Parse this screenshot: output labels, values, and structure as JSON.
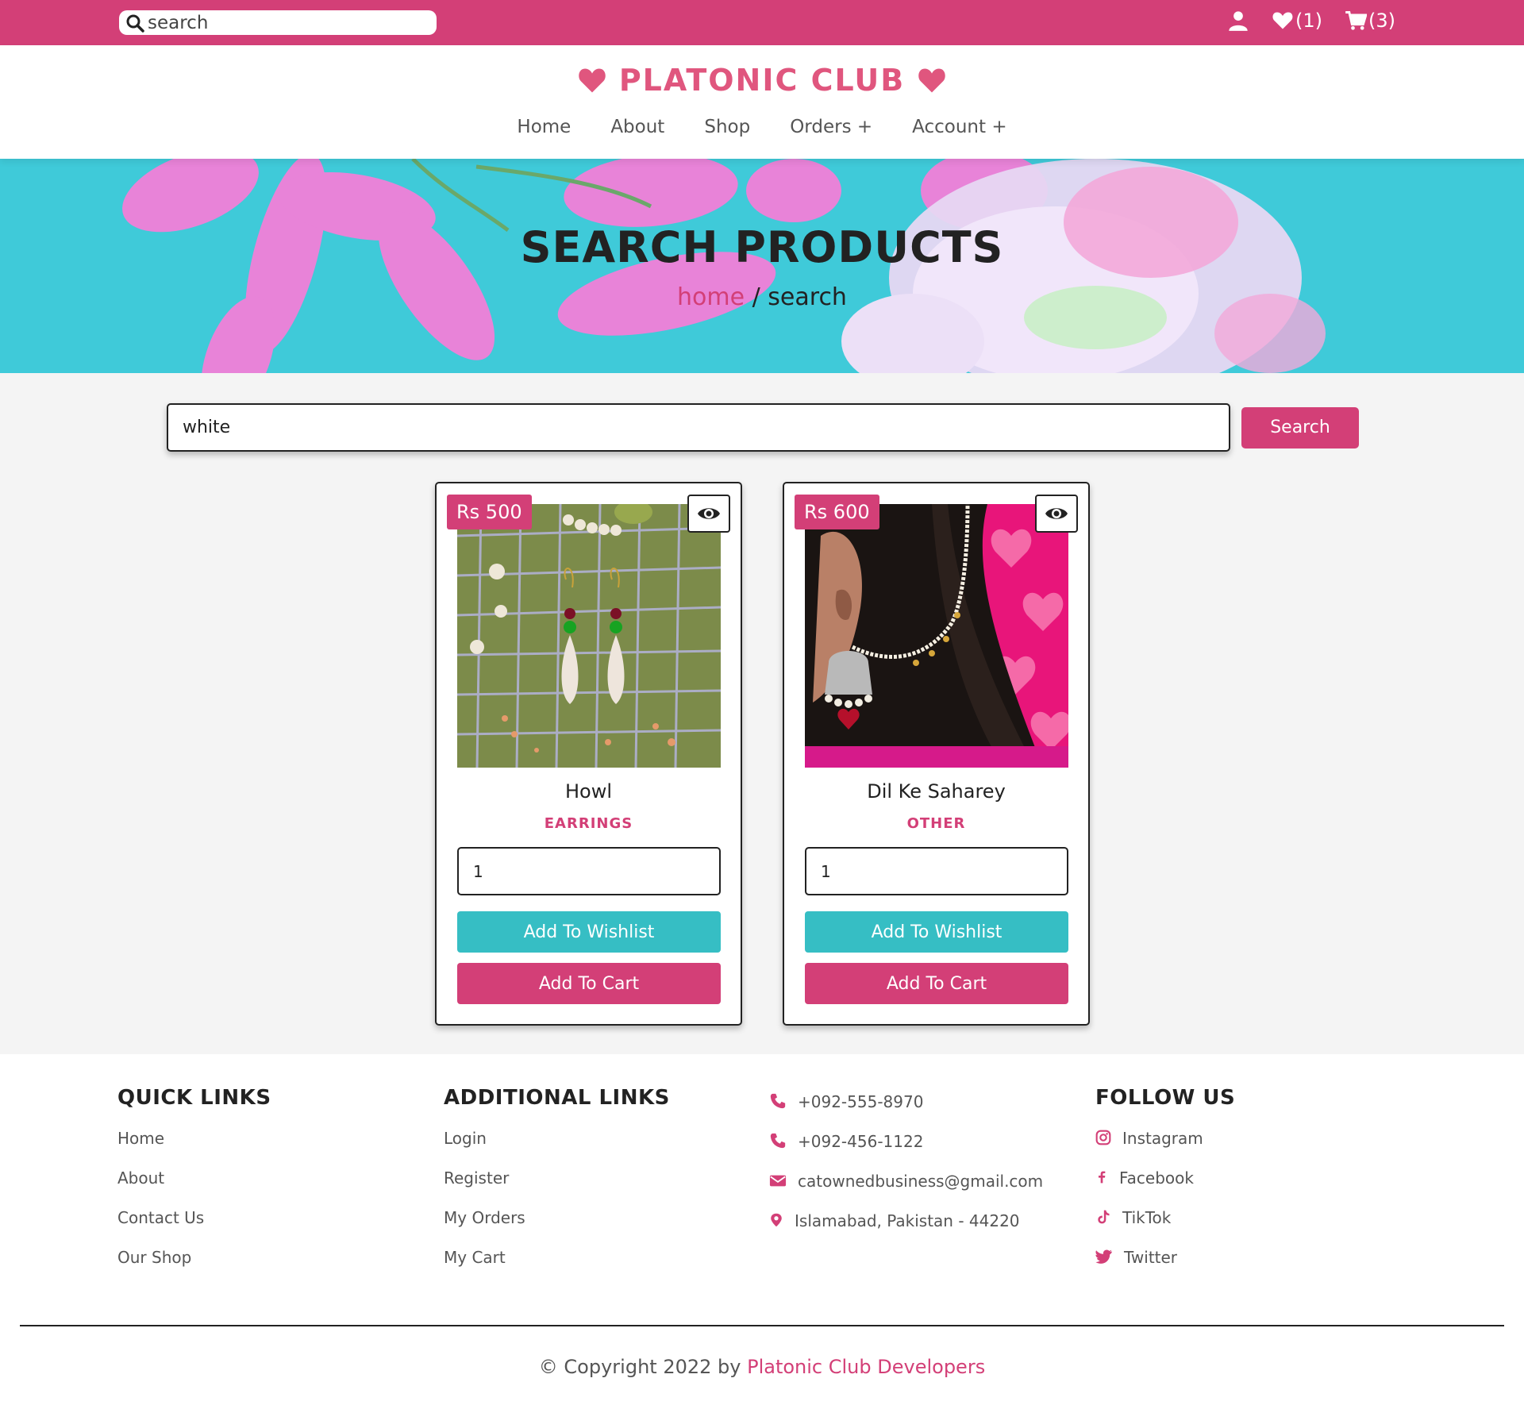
{
  "topbar": {
    "search_placeholder": "search",
    "wishlist_count": "(1)",
    "cart_count": "(3)"
  },
  "header": {
    "logo": "PLATONIC CLUB",
    "nav": [
      "Home",
      "About",
      "Shop",
      "Orders +",
      "Account +"
    ]
  },
  "hero": {
    "title": "SEARCH PRODUCTS",
    "crumb_home": "home",
    "crumb_sep": " / ",
    "crumb_current": "search"
  },
  "search": {
    "value": "white",
    "button": "Search"
  },
  "products": [
    {
      "price": "Rs 500",
      "name": "Howl",
      "category": "EARRINGS",
      "quantity": "1",
      "wishlist_label": "Add To Wishlist",
      "cart_label": "Add To Cart"
    },
    {
      "price": "Rs 600",
      "name": "Dil Ke Saharey",
      "category": "OTHER",
      "quantity": "1",
      "wishlist_label": "Add To Wishlist",
      "cart_label": "Add To Cart"
    }
  ],
  "footer": {
    "quick_links": {
      "title": "QUICK LINKS",
      "items": [
        "Home",
        "About",
        "Contact Us",
        "Our Shop"
      ]
    },
    "additional_links": {
      "title": "ADDITIONAL LINKS",
      "items": [
        "Login",
        "Register",
        "My Orders",
        "My Cart"
      ]
    },
    "contact": {
      "phone1": "+092-555-8970",
      "phone2": "+092-456-1122",
      "email": "catownedbusiness@gmail.com",
      "address": "Islamabad, Pakistan - 44220"
    },
    "follow": {
      "title": "FOLLOW US",
      "items": [
        "Instagram",
        "Facebook",
        "TikTok",
        "Twitter"
      ]
    },
    "copyright_prefix": "© Copyright 2022 by ",
    "copyright_dev": "Platonic Club Developers"
  },
  "colors": {
    "brand_pink": "#d33f77",
    "logo_pink": "#e0567e",
    "teal": "#36bec4",
    "hero_bg": "#3fcad9"
  }
}
